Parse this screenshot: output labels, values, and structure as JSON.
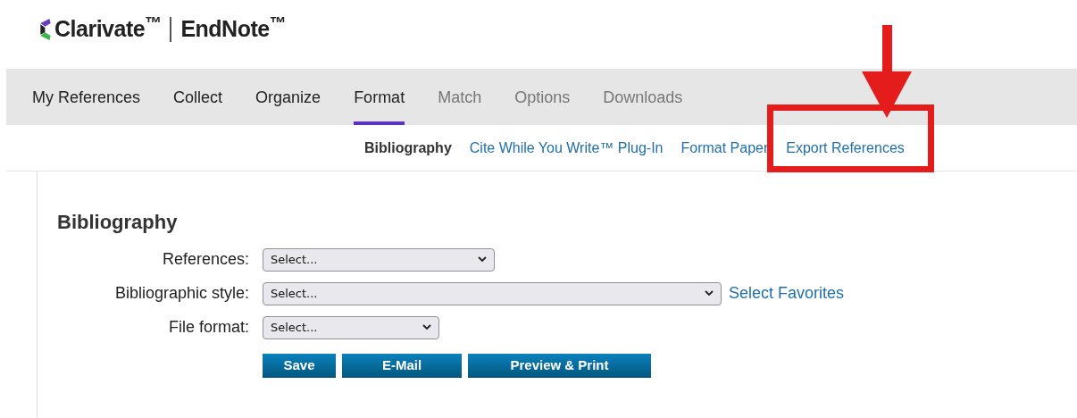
{
  "logo": {
    "brand": "Clarivate$^{™}$",
    "product": "EndNote$^{™}$"
  },
  "tabs": [
    {
      "label": "My References",
      "selected": false,
      "disabled": false
    },
    {
      "label": "Collect",
      "selected": false,
      "disabled": false
    },
    {
      "label": "Organize",
      "selected": false,
      "disabled": false
    },
    {
      "label": "Format",
      "selected": true,
      "disabled": false
    },
    {
      "label": "Match",
      "selected": false,
      "disabled": true
    },
    {
      "label": "Options",
      "selected": false,
      "disabled": true
    },
    {
      "label": "Downloads",
      "selected": false,
      "disabled": true
    }
  ],
  "subtabs": [
    {
      "label": "Bibliography",
      "selected": true,
      "highlighted": false
    },
    {
      "label": "Cite While You Write™ Plug-In",
      "selected": false,
      "highlighted": false
    },
    {
      "label": "Format Paper",
      "selected": false,
      "highlighted": false
    },
    {
      "label": "Export References",
      "selected": false,
      "highlighted": true
    }
  ],
  "panel": {
    "title": "Bibliography",
    "fields": [
      {
        "label": "References:",
        "value": "Select..."
      },
      {
        "label": "Bibliographic style:",
        "value": "Select...",
        "link": "Select Favorites"
      },
      {
        "label": "File format:",
        "value": "Select..."
      }
    ],
    "buttons": [
      "Save",
      "E-Mail",
      "Preview & Print"
    ]
  }
}
